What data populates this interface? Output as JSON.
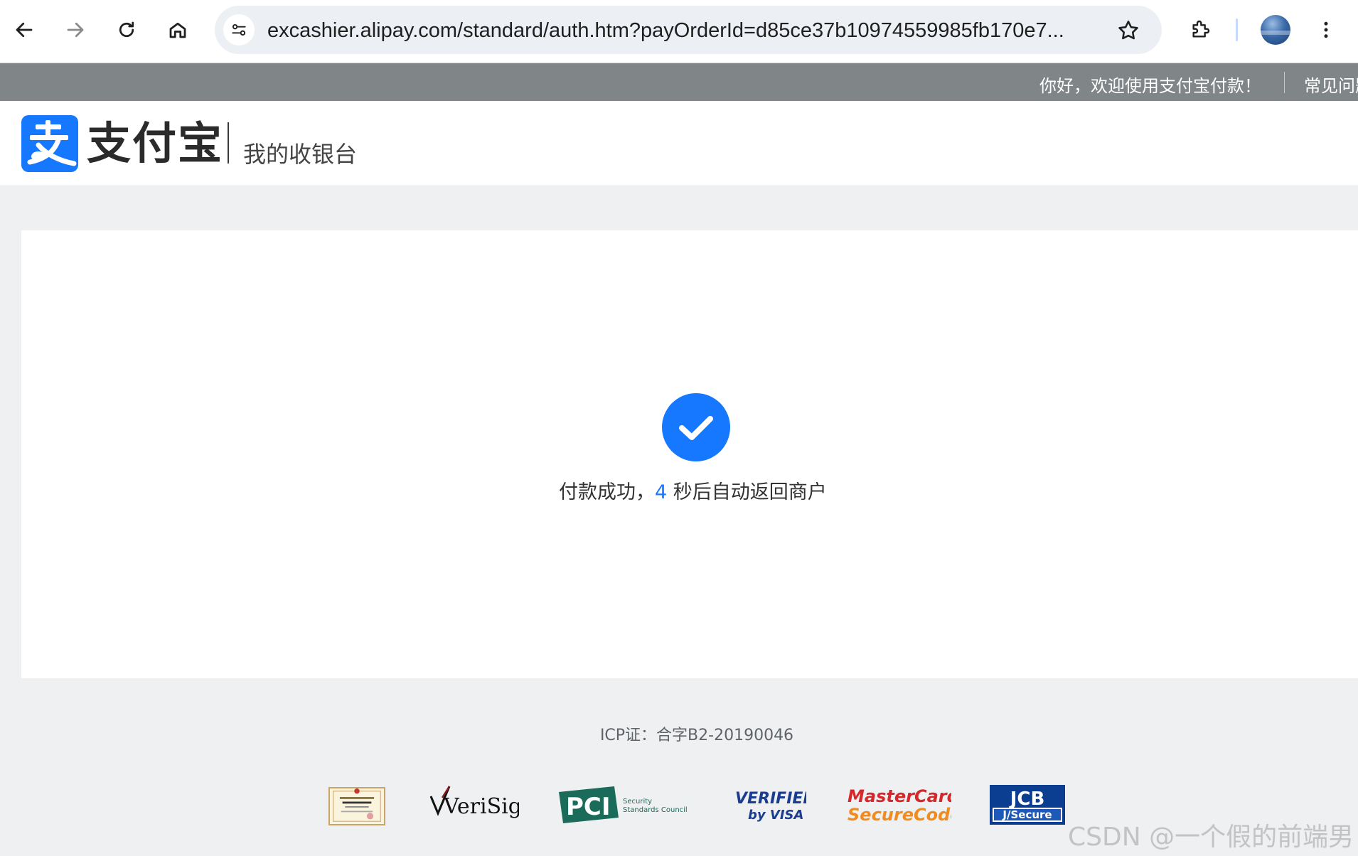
{
  "browser": {
    "url": "excashier.alipay.com/standard/auth.htm?payOrderId=d85ce37b10974559985fb170e7...",
    "icons": [
      "back-arrow-icon",
      "forward-arrow-icon",
      "reload-icon",
      "home-icon",
      "site-info-icon",
      "bookmark-star-icon",
      "extensions-icon",
      "profile-avatar",
      "more-menu-icon"
    ]
  },
  "topbar": {
    "greeting": "你好，欢迎使用支付宝付款！",
    "faq": "常见问题"
  },
  "header": {
    "brand": "支付宝",
    "subtitle": "我的收银台"
  },
  "main": {
    "message_before": "付款成功，",
    "countdown": "4",
    "message_after": " 秒后自动返回商户"
  },
  "footer": {
    "icp": "ICP证：合字B2-20190046",
    "badges": {
      "verisign": "VeriSign",
      "pci": "PCI",
      "pci_sub1": "Security",
      "pci_sub2": "Standards Council",
      "visa_line1": "VERIFIED",
      "visa_line2": "by VISA",
      "mc_line1": "MasterCard.",
      "mc_line2": "SecureCode.",
      "jcb_line1": "JCB",
      "jcb_line2": "J/Secure"
    }
  },
  "watermark": "CSDN @一个假的前端男",
  "colors": {
    "alipay_blue": "#1677ff",
    "topbar_gray": "#808588",
    "page_bg": "#eff0f1"
  }
}
